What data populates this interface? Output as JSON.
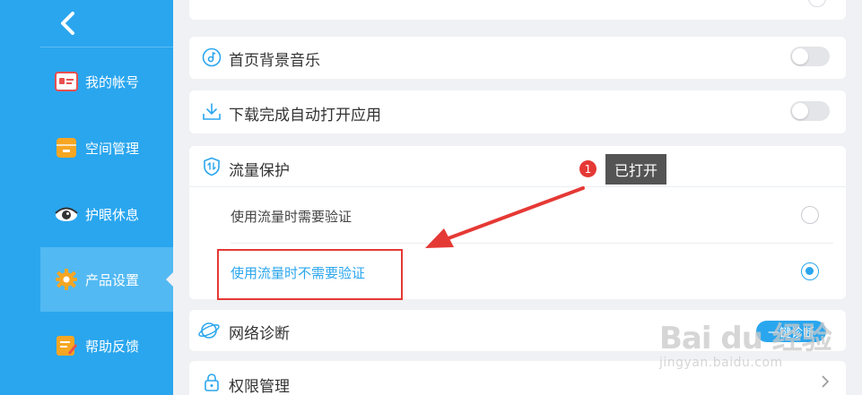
{
  "sidebar": {
    "items": [
      {
        "label": "我的帐号",
        "icon": "account-card-icon"
      },
      {
        "label": "空间管理",
        "icon": "storage-icon"
      },
      {
        "label": "护眼休息",
        "icon": "eye-icon"
      },
      {
        "label": "产品设置",
        "icon": "gear-icon",
        "active": true
      },
      {
        "label": "帮助反馈",
        "icon": "feedback-icon"
      }
    ]
  },
  "settings": {
    "music": {
      "label": "首页背景音乐",
      "icon": "music-icon",
      "enabled": false
    },
    "auto_open": {
      "label": "下载完成自动打开应用",
      "icon": "download-icon",
      "enabled": false
    },
    "traffic": {
      "label": "流量保护",
      "icon": "traffic-shield-icon",
      "options": [
        {
          "label": "使用流量时需要验证",
          "selected": false
        },
        {
          "label": "使用流量时不需要验证",
          "selected": true
        }
      ]
    },
    "network": {
      "label": "网络诊断",
      "icon": "globe-icon",
      "button_label": "一键诊断"
    },
    "permission": {
      "label": "权限管理",
      "icon": "lock-icon"
    }
  },
  "annotation": {
    "step_number": "1",
    "callout_text": "已打开"
  },
  "watermark": {
    "main": "Bai du 经验",
    "sub": "jingyan.baidu.com"
  },
  "colors": {
    "sidebar": "#2aa6ee",
    "accent": "#2aa6ee",
    "annotation_red": "#e53935"
  }
}
